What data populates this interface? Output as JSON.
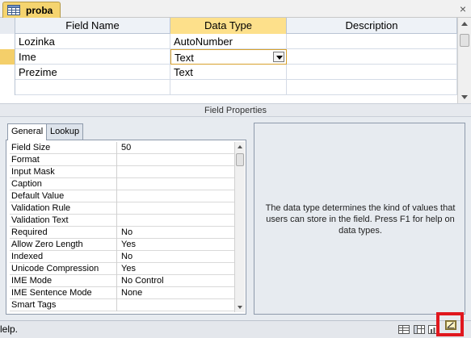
{
  "window": {
    "tab_title": "proba",
    "close_glyph": "×"
  },
  "grid": {
    "headers": [
      "Field Name",
      "Data Type",
      "Description"
    ],
    "rows": [
      {
        "field_name": "Lozinka",
        "data_type": "AutoNumber",
        "description": ""
      },
      {
        "field_name": "Ime",
        "data_type": "Text",
        "description": ""
      },
      {
        "field_name": "Prezime",
        "data_type": "Text",
        "description": ""
      }
    ]
  },
  "field_properties": {
    "bar_label": "Field Properties",
    "tabs": [
      "General",
      "Lookup"
    ],
    "rows": [
      {
        "name": "Field Size",
        "value": "50"
      },
      {
        "name": "Format",
        "value": ""
      },
      {
        "name": "Input Mask",
        "value": ""
      },
      {
        "name": "Caption",
        "value": ""
      },
      {
        "name": "Default Value",
        "value": ""
      },
      {
        "name": "Validation Rule",
        "value": ""
      },
      {
        "name": "Validation Text",
        "value": ""
      },
      {
        "name": "Required",
        "value": "No"
      },
      {
        "name": "Allow Zero Length",
        "value": "Yes"
      },
      {
        "name": "Indexed",
        "value": "No"
      },
      {
        "name": "Unicode Compression",
        "value": "Yes"
      },
      {
        "name": "IME Mode",
        "value": "No Control"
      },
      {
        "name": "IME Sentence Mode",
        "value": "None"
      },
      {
        "name": "Smart Tags",
        "value": ""
      }
    ],
    "help_text": "The data type determines the kind of values that users can store in the field. Press F1 for help on data types."
  },
  "status": {
    "text": "lelp."
  },
  "colors": {
    "accent": "#f5d46f",
    "highlight": "#e0171e",
    "panel": "#e7ebf0"
  }
}
